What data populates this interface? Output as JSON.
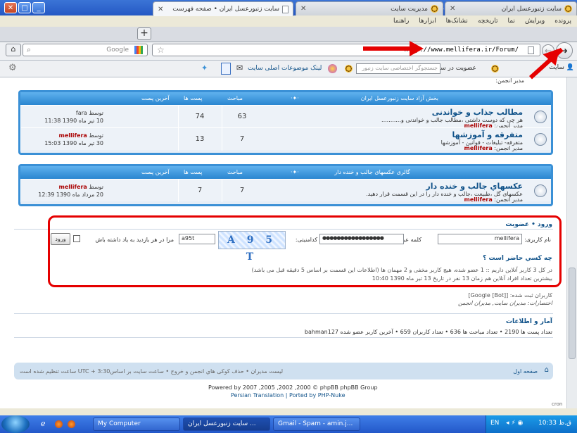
{
  "window": {
    "title": "سایت زنبورعسل ایران • صفحه فهرست - Mozilla Firefox"
  },
  "menu": [
    "پرونده",
    "ویرایش",
    "نما",
    "تاریخچه",
    "نشانک‌ها",
    "ابزارها",
    "راهنما"
  ],
  "tabs": [
    {
      "label": "سایت زنبورعسل ایران"
    },
    {
      "label": "مدیریت سایت"
    },
    {
      "label": "سایت زنبورعسل ایران • صفحه فهرست"
    }
  ],
  "nav": {
    "url": "http://www.mellifera.ir/Forum/",
    "search_placeholder": "Google"
  },
  "bookmarks": {
    "membership": "عضویت در سایت",
    "search_placeholder": "جستجوگر اختصاصی سایت زنبور",
    "topics": "لینک موضوعات اصلی سایت",
    "item1": "سایت"
  },
  "forum_top": {
    "moderator": "مدیر انجمن:"
  },
  "section1": {
    "title": "بخش آزاد سایت زنبورعسل ایران",
    "col_topics": "مباحث",
    "col_posts": "پست ها",
    "col_last": "آخرین پست",
    "forums": [
      {
        "title": "مطالب جذاب و خواندنی",
        "desc": "هر چی که دوست داشتی ،مطالب جالب و خواندنی و...........",
        "mod": "مدیر انجمن:",
        "mod_name": "mellifera",
        "topics": "63",
        "posts": "74",
        "by": "توسط",
        "last_user": "fara",
        "last_date": "10 تیر ماه 1390 11:38"
      },
      {
        "title": "متفرقه و آموزشها",
        "desc": "متفرقه- تبلیغات - قوانین - آموزشها",
        "mod": "مدیر انجمن:",
        "mod_name": "mellifera",
        "topics": "7",
        "posts": "13",
        "by": "توسط",
        "last_user": "mellifera",
        "last_date": "30 تیر ماه 1390 15:03"
      }
    ]
  },
  "section2": {
    "title": "گالری عکسهای جالب و خنده دار",
    "col_topics": "مباحث",
    "col_posts": "پست ها",
    "col_last": "آخرین پست",
    "forums": [
      {
        "title": "عکسهاي جالب و خنده دار",
        "desc": "عکسهای گل ،طبیعت ،جالب و خنده دار را در این قسمت قرار دهید.",
        "mod": "مدیر انجمن:",
        "mod_name": "mellifera",
        "topics": "7",
        "posts": "7",
        "by": "توسط",
        "last_user": "mellifera",
        "last_date": "20 مرداد ماه 1390 12:39"
      }
    ]
  },
  "login": {
    "header": "ورود • عضویت",
    "username_label": "نام کاربری:",
    "username_value": "mellifera",
    "password_label": "کلمه عبور:",
    "password_value": "●●●●●●●●●●●●●●●●●",
    "captcha_label": "کدامنیتی:",
    "captcha_image": "A 9 5 T",
    "captcha_value": "a95t",
    "remember": "مرا در هر بازدید به یاد داشته باش",
    "submit": "ورود"
  },
  "online": {
    "title": "چه کسي حاضر است ؟",
    "line1": "در کل 3 کاربر آنلاین داریم :: 1 عضو شده، هیچ کاربر مخفی و 2 مهمان ها (اطلاعات این قسمت بر اساس 5 دقیقه قبل می باشد)",
    "line2": "بیشترین تعداد افراد آنلاین هم زمان 13 نفر در تاریخ 13 تیر ماه 1390 10:40",
    "users": "کاربران ثبت شده: [Google [Bot]]",
    "legend": "اختصارات: مديران سايت, مديران انجمن"
  },
  "stats": {
    "title": "آمار و اطلاعات",
    "line": "تعداد پست ها 2190 • تعداد مباحث ها 636 • تعداد کاربران 659 • آخرین کاربر عضو شده bahman127"
  },
  "footer": {
    "home": "صفحه اول",
    "links": "لیست مدیران • حذف کوکی هاي انجمن و خروج • ساعت سایت بر اساس3:30 + UTC ساعت تنظیم شده است",
    "powered": "Powered by 2007 ,2005 ,2002 ,2000 © phpBB phpBB Group",
    "translation": "Persian Translation | Ported by PHP-Nuke",
    "cron": "cron"
  },
  "taskbar": {
    "items": [
      "My Computer",
      "سایت زنبورعسل ایران ...",
      "Gmail - Spam - amin.j..."
    ],
    "lang": "EN",
    "time": "10:33 ق.ظ"
  }
}
